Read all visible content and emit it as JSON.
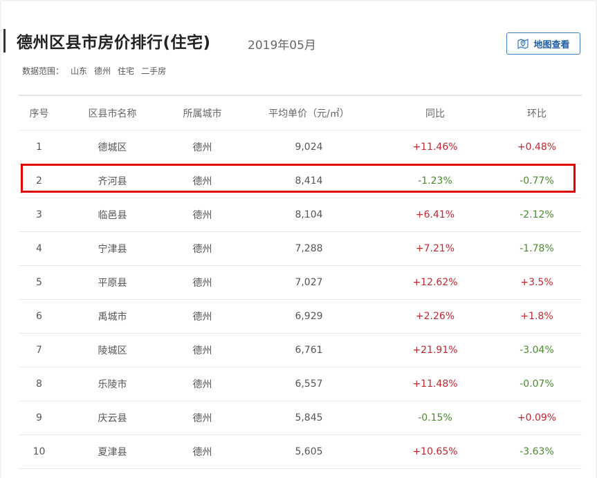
{
  "header": {
    "title": "德州区县市房价排行(住宅)",
    "period": "2019年05月",
    "map_button_label": "地图查看",
    "scope_label": "数据范围：",
    "scope_tags": [
      "山东",
      "德州",
      "住宅",
      "二手房"
    ]
  },
  "colors": {
    "up": "#c2262e",
    "down": "#4a8a2e",
    "accent": "#1f5fa6",
    "highlight": "#e00000"
  },
  "table": {
    "columns": [
      "序号",
      "区县市名称",
      "所属城市",
      "平均单价（元/㎡）",
      "同比",
      "环比"
    ],
    "rows": [
      {
        "rank": "1",
        "name": "德城区",
        "city": "德州",
        "price": "9,024",
        "yoy": "+11.46%",
        "mom": "+0.48%"
      },
      {
        "rank": "2",
        "name": "齐河县",
        "city": "德州",
        "price": "8,414",
        "yoy": "-1.23%",
        "mom": "-0.77%"
      },
      {
        "rank": "3",
        "name": "临邑县",
        "city": "德州",
        "price": "8,104",
        "yoy": "+6.41%",
        "mom": "-2.12%"
      },
      {
        "rank": "4",
        "name": "宁津县",
        "city": "德州",
        "price": "7,288",
        "yoy": "+7.21%",
        "mom": "-1.78%"
      },
      {
        "rank": "5",
        "name": "平原县",
        "city": "德州",
        "price": "7,027",
        "yoy": "+12.62%",
        "mom": "+3.5%"
      },
      {
        "rank": "6",
        "name": "禹城市",
        "city": "德州",
        "price": "6,929",
        "yoy": "+2.26%",
        "mom": "+1.8%"
      },
      {
        "rank": "7",
        "name": "陵城区",
        "city": "德州",
        "price": "6,761",
        "yoy": "+21.91%",
        "mom": "-3.04%"
      },
      {
        "rank": "8",
        "name": "乐陵市",
        "city": "德州",
        "price": "6,557",
        "yoy": "+11.48%",
        "mom": "-0.07%"
      },
      {
        "rank": "9",
        "name": "庆云县",
        "city": "德州",
        "price": "5,845",
        "yoy": "-0.15%",
        "mom": "+0.09%"
      },
      {
        "rank": "10",
        "name": "夏津县",
        "city": "德州",
        "price": "5,605",
        "yoy": "+10.65%",
        "mom": "-3.63%"
      }
    ]
  }
}
